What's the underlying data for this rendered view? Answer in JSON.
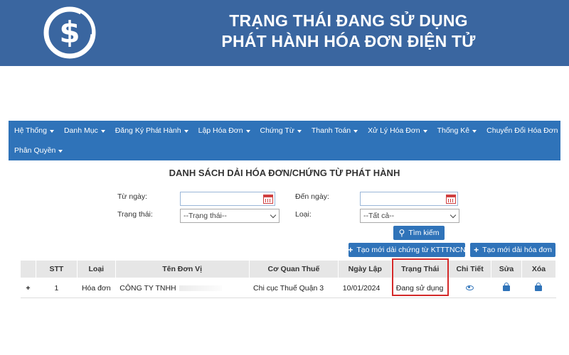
{
  "banner": {
    "title_line1": "TRẠNG THÁI ĐANG SỬ DỤNG",
    "title_line2": "PHÁT HÀNH HÓA ĐƠN ĐIỆN TỬ",
    "logo_icon": "dollar-logo-icon",
    "bg_color": "#3a66a0"
  },
  "nav": {
    "row1": [
      "Hệ Thống",
      "Danh Mục",
      "Đăng Ký Phát Hành",
      "Lập Hóa Đơn",
      "Chứng Từ",
      "Thanh Toán",
      "Xử Lý Hóa Đơn",
      "Thống Kê",
      "Chuyển Đổi Hóa Đơn"
    ],
    "row2": [
      "Phân Quyền"
    ],
    "bg_color": "#2f73b9"
  },
  "page": {
    "title": "DANH SÁCH DẢI HÓA ĐƠN/CHỨNG TỪ PHÁT HÀNH"
  },
  "filters": {
    "from_date_label": "Từ ngày:",
    "to_date_label": "Đến ngày:",
    "status_label": "Trạng thái:",
    "status_value": "--Trạng thái--",
    "type_label": "Loại:",
    "type_value": "--Tất cả--",
    "search_label": "Tìm kiếm"
  },
  "actions": {
    "create_tnct_label": "Tạo mới dải chứng từ KTTTNCN",
    "create_invoice_label": "Tạo mới dải hóa đơn"
  },
  "table": {
    "headers": [
      "",
      "STT",
      "Loại",
      "Tên Đơn Vị",
      "Cơ Quan Thuế",
      "Ngày Lập",
      "Trạng Thái",
      "Chi Tiết",
      "Sửa",
      "Xóa"
    ],
    "rows": [
      {
        "stt": "1",
        "type": "Hóa đơn",
        "unit": "CÔNG TY TNHH",
        "tax_office": "Chi cục Thuế Quận 3",
        "date": "10/01/2024",
        "status": "Đang sử dụng"
      }
    ]
  },
  "accent_colors": {
    "highlight": "#d42a2a",
    "primary": "#2f73b9"
  }
}
